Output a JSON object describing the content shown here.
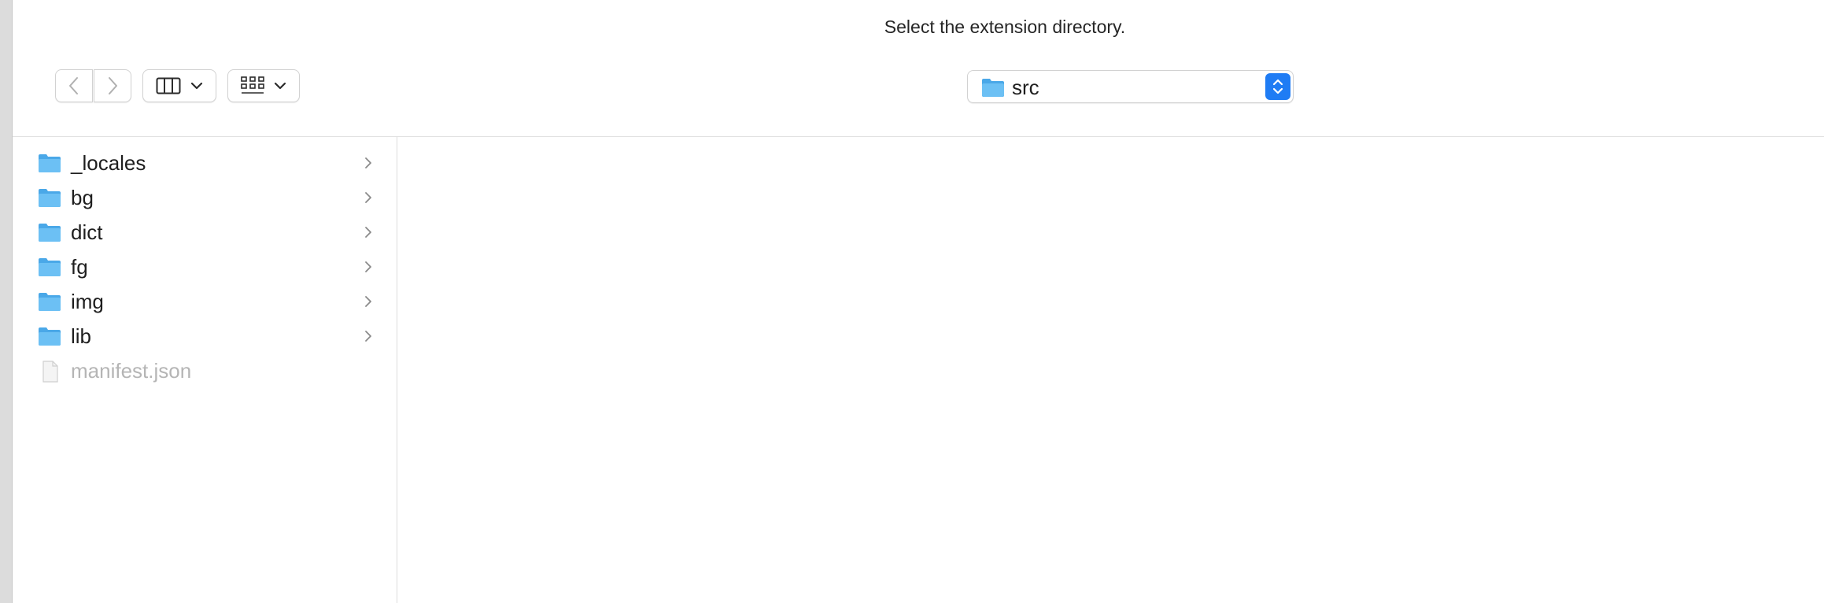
{
  "dialog": {
    "prompt": "Select the extension directory."
  },
  "toolbar": {
    "back_icon": "chevron-left-icon",
    "forward_icon": "chevron-right-icon",
    "view_icon": "column-view-icon",
    "group_icon": "grid-group-icon"
  },
  "path_popup": {
    "current": "src",
    "icon": "folder-icon"
  },
  "column": {
    "items": [
      {
        "label": "_locales",
        "kind": "folder"
      },
      {
        "label": "bg",
        "kind": "folder"
      },
      {
        "label": "dict",
        "kind": "folder"
      },
      {
        "label": "fg",
        "kind": "folder"
      },
      {
        "label": "img",
        "kind": "folder"
      },
      {
        "label": "lib",
        "kind": "folder"
      },
      {
        "label": "manifest.json",
        "kind": "file"
      }
    ]
  },
  "colors": {
    "accent": "#1f7cf4",
    "folder": "#5fb6ef",
    "disabled_text": "#b5b5b5"
  }
}
